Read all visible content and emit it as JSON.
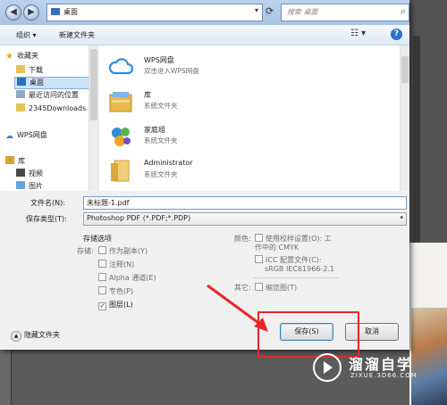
{
  "address_bar": {
    "path": "桌面",
    "search_placeholder": "搜索 桌面"
  },
  "toolbar": {
    "organize_label": "组织 ▾",
    "new_folder_label": "新建文件夹",
    "help_label": "?"
  },
  "nav_pane": {
    "favorites_header": "收藏夹",
    "items": [
      {
        "label": "下载"
      },
      {
        "label": "桌面"
      },
      {
        "label": "最近访问的位置"
      },
      {
        "label": "2345Downloads"
      }
    ],
    "wps_cloud": "WPS网盘",
    "library_header": "库",
    "library_items": [
      {
        "label": "视频"
      },
      {
        "label": "图片"
      }
    ]
  },
  "files": [
    {
      "name": "WPS网盘",
      "sub": "双击进入WPS网盘",
      "icon": "cloud-icon"
    },
    {
      "name": "库",
      "sub": "系统文件夹",
      "icon": "library-icon"
    },
    {
      "name": "家庭组",
      "sub": "系统文件夹",
      "icon": "homegroup-icon"
    },
    {
      "name": "Administrator",
      "sub": "系统文件夹",
      "icon": "user-folder-icon"
    }
  ],
  "form": {
    "filename_label": "文件名(N):",
    "filename_value": "未标题-1.pdf",
    "filetype_label": "保存类型(T):",
    "filetype_value": "Photoshop PDF (*.PDF;*.PDP)"
  },
  "save_options": {
    "header": "存储选项",
    "storage_label": "存储:",
    "options": [
      {
        "label": "作为副本(Y)",
        "checked": false
      },
      {
        "label": "注释(N)",
        "checked": false
      },
      {
        "label": "Alpha 通道(E)",
        "checked": false
      },
      {
        "label": "专色(P)",
        "checked": false
      },
      {
        "label": "图层(L)",
        "checked": true
      }
    ],
    "color_label": "颜色:",
    "use_proof_label": "使用校样设置(O): 工作中的 CMYK",
    "icc_label": "ICC 配置文件(C):",
    "icc_value": "sRGB IEC61966-2.1",
    "other_label": "其它:",
    "thumbnail_label": "缩览图(T)"
  },
  "footer": {
    "hide_folders_label": "隐藏文件夹",
    "save_button": "保存(S)",
    "cancel_button": "取消"
  },
  "watermark": {
    "brand": "溜溜自学",
    "url": "ZIXUE.3D66.COM"
  },
  "colors": {
    "annotation_red": "#e8262a",
    "selection_blue": "#cde3fb"
  }
}
